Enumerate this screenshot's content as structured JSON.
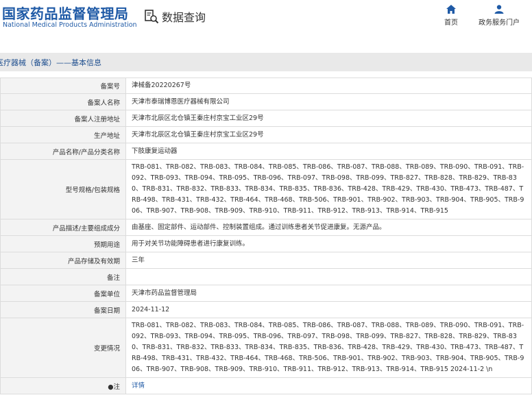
{
  "header": {
    "logo_cn": "国家药品监督管理局",
    "logo_en": "National Medical Products Administration",
    "query_title": "数据查询",
    "nav_home": "首页",
    "nav_portal": "政务服务门户"
  },
  "section_title": "医疗器械（备案）——基本信息",
  "rows": [
    {
      "label": "备案号",
      "value": "津械备20220267号"
    },
    {
      "label": "备案人名称",
      "value": "天津市泰瑞博恩医疗器械有限公司"
    },
    {
      "label": "备案人注册地址",
      "value": "天津市北辰区北仓镇王秦庄村京宝工业区29号"
    },
    {
      "label": "生产地址",
      "value": "天津市北辰区北仓镇王秦庄村京宝工业区29号"
    },
    {
      "label": "产品名称/产品分类名称",
      "value": "下肢康复运动器"
    },
    {
      "label": "型号规格/包装规格",
      "value": "TRB-081、TRB-082、TRB-083、TRB-084、TRB-085、TRB-086、TRB-087、TRB-088、TRB-089、TRB-090、TRB-091、TRB-092、TRB-093、TRB-094、TRB-095、TRB-096、TRB-097、TRB-098、TRB-099、TRB-827、TRB-828、TRB-829、TRB-830、TRB-831、TRB-832、TRB-833、TRB-834、TRB-835、TRB-836、TRB-428、TRB-429、TRB-430、TRB-473、TRB-487、TRB-498、TRB-431、TRB-432、TRB-464、TRB-468、TRB-506、TRB-901、TRB-902、TRB-903、TRB-904、TRB-905、TRB-906、TRB-907、TRB-908、TRB-909、TRB-910、TRB-911、TRB-912、TRB-913、TRB-914、TRB-915"
    },
    {
      "label": "产品描述/主要组成成分",
      "value": "由基座、固定部件、运动部件、控制装置组成。通过训练患者关节促进康复。无源产品。"
    },
    {
      "label": "预期用途",
      "value": "用于对关节功能障碍患者进行康复训练。"
    },
    {
      "label": "产品存储及有效期",
      "value": "三年"
    },
    {
      "label": "备注",
      "value": ""
    },
    {
      "label": "备案单位",
      "value": "天津市药品监督管理局"
    },
    {
      "label": "备案日期",
      "value": "2024-11-12"
    },
    {
      "label": "变更情况",
      "value": "TRB-081、TRB-082、TRB-083、TRB-084、TRB-085、TRB-086、TRB-087、TRB-088、TRB-089、TRB-090、TRB-091、TRB-092、TRB-093、TRB-094、TRB-095、TRB-096、TRB-097、TRB-098、TRB-099、TRB-827、TRB-828、TRB-829、TRB-830、TRB-831、TRB-832、TRB-833、TRB-834、TRB-835、TRB-836、TRB-428、TRB-429、TRB-430、TRB-473、TRB-487、TRB-498、TRB-431、TRB-432、TRB-464、TRB-468、TRB-506、TRB-901、TRB-902、TRB-903、TRB-904、TRB-905、TRB-906、TRB-907、TRB-908、TRB-909、TRB-910、TRB-911、TRB-912、TRB-913、TRB-914、TRB-915 2024-11-2 \\n"
    },
    {
      "label": "●注",
      "value": "详情"
    }
  ],
  "colors": {
    "brand": "#1f5aa6",
    "label_bg": "#f3f3f3",
    "title_bar_bg": "#e9e9e9",
    "border": "#dcdcdc"
  },
  "icons": {
    "query": "magnifier-document-icon",
    "home": "home-icon",
    "portal": "user-icon"
  }
}
